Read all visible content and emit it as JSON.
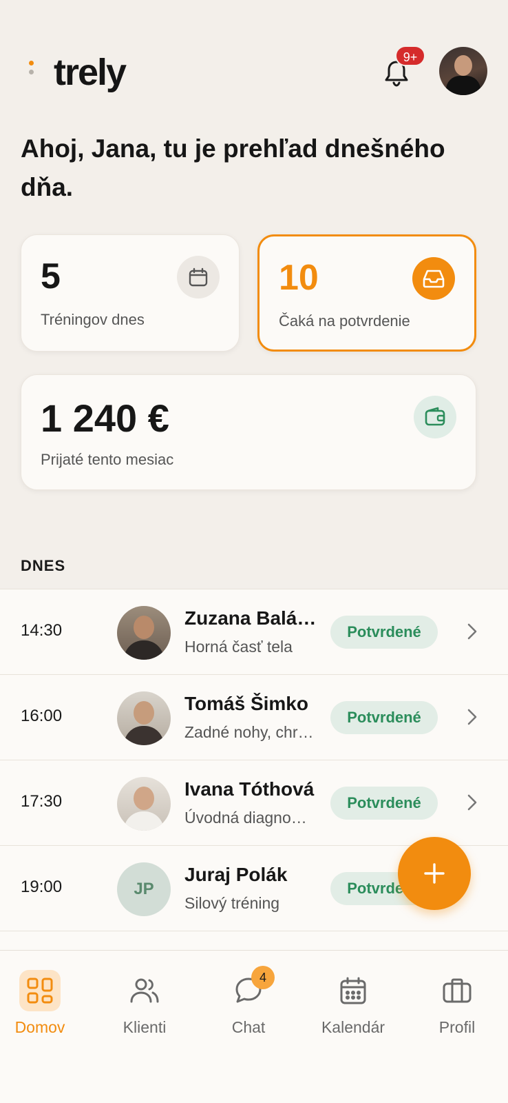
{
  "header": {
    "logo": "trely",
    "notifications_badge": "9+"
  },
  "greeting": "Ahoj, Jana, tu je prehľad dnešného dňa.",
  "cards": {
    "sessions": {
      "value": "5",
      "label": "Tréningov dnes",
      "icon": "calendar-icon"
    },
    "pending": {
      "value": "10",
      "label": "Čaká na potvrdenie",
      "icon": "inbox-icon"
    },
    "income": {
      "value": "1 240 €",
      "label": "Prijaté tento mesiac",
      "icon": "wallet-icon"
    }
  },
  "today": {
    "title": "DNES",
    "items": [
      {
        "time": "14:30",
        "name": "Zuzana Balá…",
        "sub": "Horná časť tela",
        "status": "Potvrdené",
        "avatar": "photo"
      },
      {
        "time": "16:00",
        "name": "Tomáš Šimko",
        "sub": "Zadné nohy, chr…",
        "status": "Potvrdené",
        "avatar": "photo"
      },
      {
        "time": "17:30",
        "name": "Ivana Tóthová",
        "sub": "Úvodná diagno…",
        "status": "Potvrdené",
        "avatar": "photo"
      },
      {
        "time": "19:00",
        "name": "Juraj Polák",
        "sub": "Silový tréning",
        "status": "Potvrdené",
        "initials": "JP"
      }
    ]
  },
  "nav": {
    "items": [
      {
        "label": "Domov",
        "icon": "grid-icon"
      },
      {
        "label": "Klienti",
        "icon": "users-icon"
      },
      {
        "label": "Chat",
        "icon": "chat-icon",
        "badge": "4"
      },
      {
        "label": "Kalendár",
        "icon": "calendar-icon"
      },
      {
        "label": "Profil",
        "icon": "briefcase-icon"
      }
    ]
  },
  "colors": {
    "accent": "#f28c0f",
    "success": "#2b8d5b",
    "background": "#f3efea"
  }
}
